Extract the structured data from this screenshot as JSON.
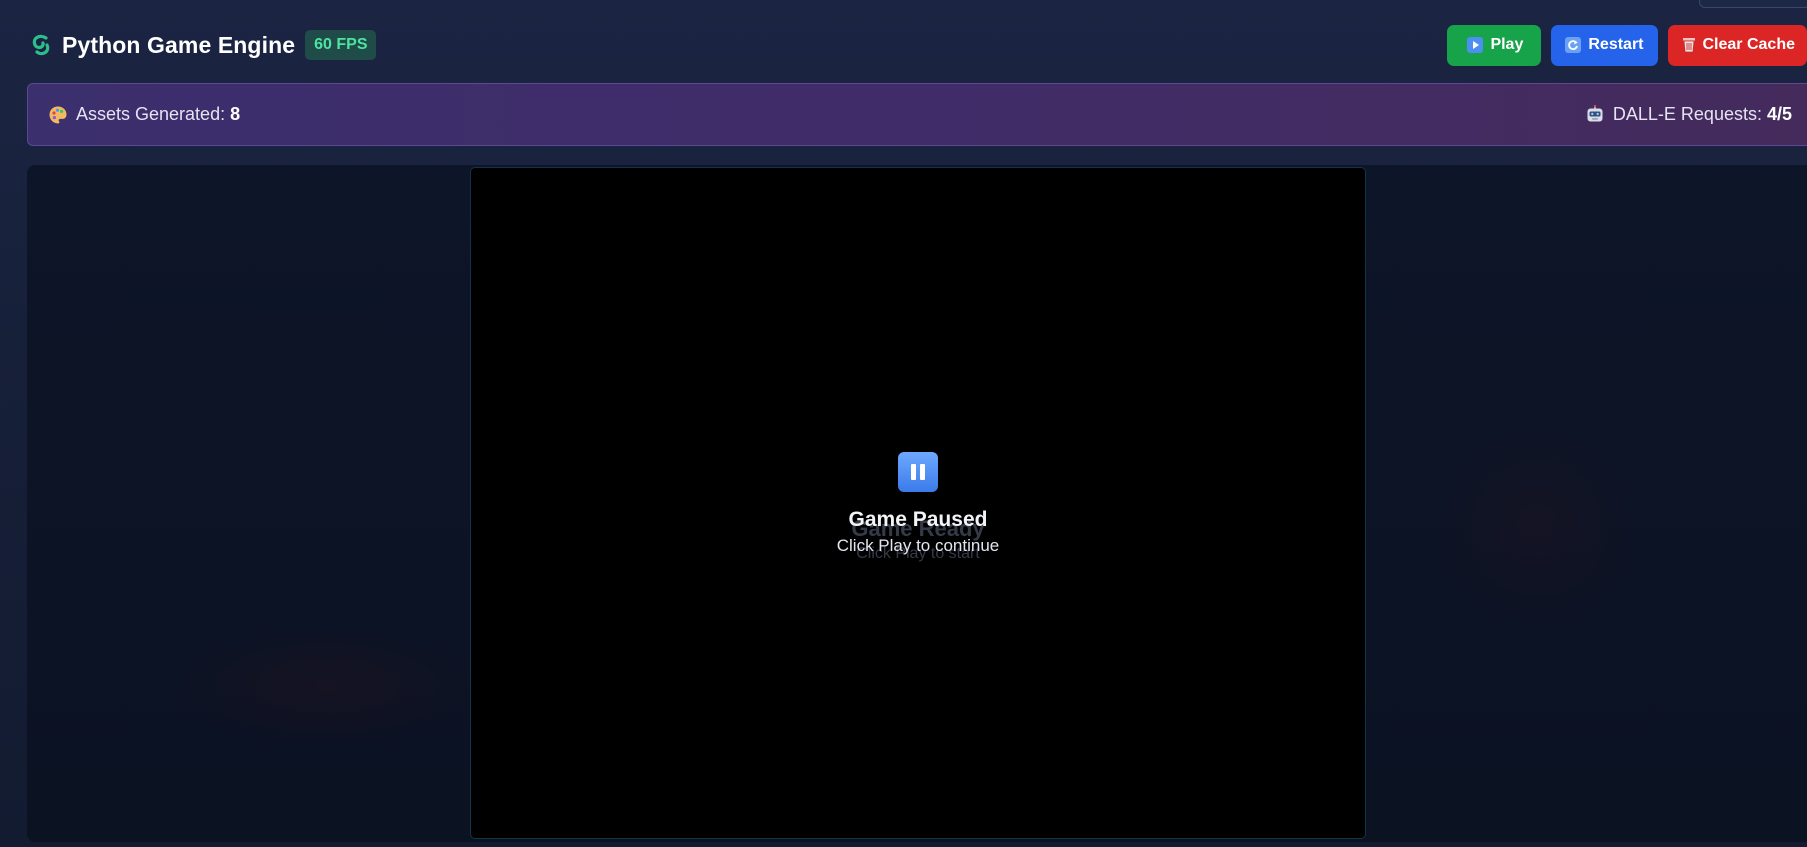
{
  "header": {
    "logo_icon": "snake-icon",
    "title": "Python Game Engine",
    "fps_badge": "60 FPS"
  },
  "actions": {
    "play": {
      "label": "Play",
      "icon": "play-icon",
      "color": "#16a34a"
    },
    "restart": {
      "label": "Restart",
      "icon": "refresh-icon",
      "color": "#2563eb"
    },
    "clear_cache": {
      "label": "Clear Cache",
      "icon": "trash-icon",
      "color": "#dc2626"
    }
  },
  "info": {
    "assets_label": "Assets Generated:",
    "assets_value": "8",
    "assets_icon": "palette-icon",
    "dalle_label": "DALL-E Requests:",
    "dalle_value": "4/5",
    "dalle_icon": "robot-icon"
  },
  "canvas": {
    "underlay_title": "Game Ready",
    "underlay_subtitle": "Click Play to start",
    "overlay_title": "Game Paused",
    "overlay_subtitle": "Click Play to continue",
    "overlay_icon": "pause-icon"
  }
}
